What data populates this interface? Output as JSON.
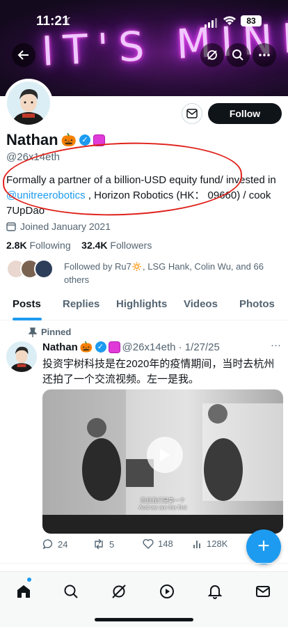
{
  "status_bar": {
    "time": "11:21",
    "battery": "83"
  },
  "banner": {
    "neon_text": "IT'S MINE"
  },
  "profile": {
    "name": "Nathan",
    "name_emoji": "🎃",
    "handle": "@26x14eth",
    "follow_label": "Follow",
    "bio_part1": "Formally a partner of a billion-USD equity fund/ invested in ",
    "bio_link": "@unitreerobotics",
    "bio_part2": " , Horizon Robotics (HK： 09660) / cook 7UpDao",
    "joined": "Joined January 2021",
    "following_count": "2.8K",
    "following_label": "Following",
    "followers_count": "32.4K",
    "followers_label": "Followers",
    "followed_by": "Followed by Ru7🔅, LSG Hank, Colin Wu, and 66 others"
  },
  "tabs": [
    "Posts",
    "Replies",
    "Highlights",
    "Videos",
    "Photos"
  ],
  "post": {
    "pinned_label": "Pinned",
    "author": "Nathan",
    "author_emoji": "🎃",
    "handle_date": "@26x14eth · 1/27/25",
    "text": "投资宇树科技是在2020年的疫情期间，当时去杭州还拍了一个交流视频。左一是我。",
    "video_subtitle_1": "而且我们是第一个",
    "video_subtitle_2": "And we are the first",
    "replies": "24",
    "reposts": "5",
    "likes": "148",
    "views": "128K"
  },
  "colors": {
    "accent": "#1d9bf0",
    "text": "#0f1419",
    "muted": "#536471",
    "annotation": "#e0211a"
  },
  "icons": [
    "back-arrow-icon",
    "grok-icon",
    "search-icon",
    "more-icon",
    "mail-icon",
    "calendar-icon",
    "pin-icon",
    "reply-icon",
    "repost-icon",
    "like-icon",
    "views-icon",
    "plus-icon",
    "home-icon",
    "explore-icon",
    "grok-nav-icon",
    "video-icon",
    "bell-icon",
    "messages-icon"
  ]
}
